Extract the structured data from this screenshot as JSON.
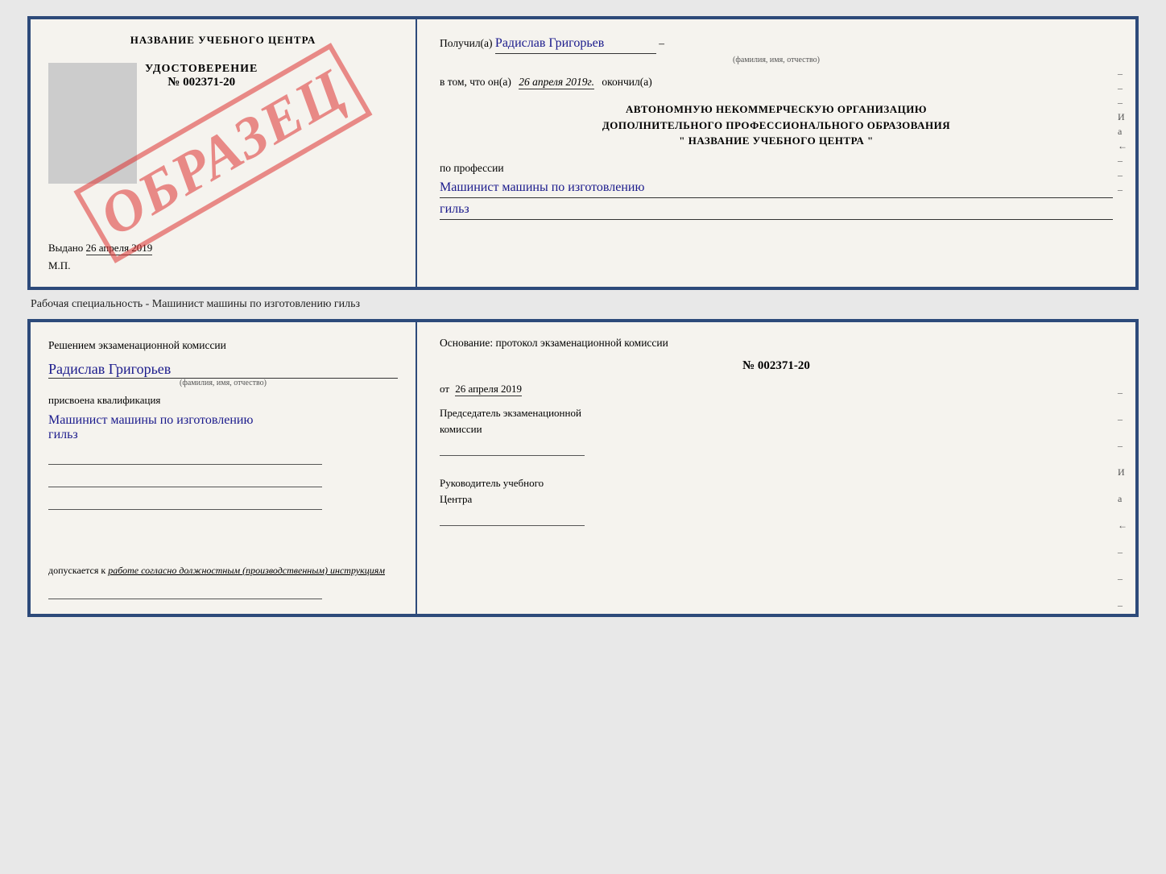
{
  "top_cert": {
    "left": {
      "title": "НАЗВАНИЕ УЧЕБНОГО ЦЕНТРА",
      "stamp": "ОБРАЗЕЦ",
      "udostoverenie_label": "УДОСТОВЕРЕНИЕ",
      "number": "№ 002371-20",
      "vydano_label": "Выдано",
      "vydano_date": "26 апреля 2019",
      "mp": "М.П."
    },
    "right": {
      "poluchil_prefix": "Получил(а)",
      "recipient_name": "Радислав Григорьев",
      "recipient_sub": "(фамилия, имя, отчество)",
      "vtom_prefix": "в том, что он(а)",
      "vtom_date": "26 апреля 2019г.",
      "okончил_label": "окончил(а)",
      "org_line1": "АВТОНОМНУЮ НЕКОММЕРЧЕСКУЮ ОРГАНИЗАЦИЮ",
      "org_line2": "ДОПОЛНИТЕЛЬНОГО ПРОФЕССИОНАЛЬНОГО ОБРАЗОВАНИЯ",
      "org_line3": "\"  НАЗВАНИЕ УЧЕБНОГО ЦЕНТРА  \"",
      "po_professii": "по профессии",
      "profession_line1": "Машинист машины по изготовлению",
      "profession_line2": "гильз",
      "dashes": [
        "–",
        "–",
        "–",
        "И",
        "а",
        "←",
        "–",
        "–",
        "–"
      ]
    }
  },
  "caption": "Рабочая специальность - Машинист машины по изготовлению гильз",
  "bottom_cert": {
    "left": {
      "resheniem_label": "Решением экзаменационной комиссии",
      "person_name": "Радислав Григорьев",
      "person_sub": "(фамилия, имя, отчество)",
      "prisvoena_label": "присвоена квалификация",
      "profession_line1": "Машинист машины по изготовлению",
      "profession_line2": "гильз",
      "dopuskaetsya_prefix": "допускается к",
      "dopuskaetsya_text": "работе согласно должностным (производственным) инструкциям"
    },
    "right": {
      "osnovaniye_label": "Основание: протокол экзаменационной комиссии",
      "protocol_num": "№ 002371-20",
      "ot_label": "от",
      "protocol_date": "26 апреля 2019",
      "predsedatel_line1": "Председатель экзаменационной",
      "predsedatel_line2": "комиссии",
      "rukovoditel_line1": "Руководитель учебного",
      "rukovoditel_line2": "Центра",
      "dashes": [
        "–",
        "–",
        "–",
        "И",
        "а",
        "←",
        "–",
        "–",
        "–"
      ]
    }
  }
}
